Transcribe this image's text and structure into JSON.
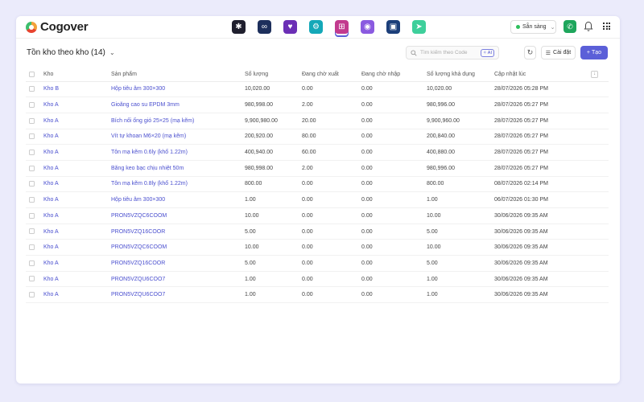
{
  "app": {
    "name": "Cogover"
  },
  "topbar": {
    "apps": [
      {
        "icon": "apps-grid-icon",
        "color": "#1f1f2e",
        "glyph": "✱"
      },
      {
        "icon": "link-icon",
        "color": "#1d2f5c",
        "glyph": "∞"
      },
      {
        "icon": "heart-icon",
        "color": "#6b2fb5",
        "glyph": "♥"
      },
      {
        "icon": "gear-icon",
        "color": "#14a8b8",
        "glyph": "⚙"
      },
      {
        "icon": "org-chart-icon",
        "color": "#c23a8e",
        "glyph": "⊞"
      },
      {
        "icon": "chat-icon",
        "color": "#8a5ae0",
        "glyph": "◉"
      },
      {
        "icon": "warehouse-icon",
        "color": "#1c3f7a",
        "glyph": "▣"
      },
      {
        "icon": "send-icon",
        "color": "#3ecf9b",
        "glyph": "➤"
      }
    ],
    "active_app_index": 4,
    "status": "Sẵn sàng",
    "status_color": "#2ebf5c"
  },
  "page": {
    "title": "Tồn kho theo kho (14)",
    "search_placeholder": "Tìm kiếm theo Code",
    "ai_label": "AI",
    "settings_label": "Cài đặt",
    "create_label": "Tạo"
  },
  "table": {
    "headers": [
      "Kho",
      "Sản phẩm",
      "Số lượng",
      "Đang chờ xuất",
      "Đang chờ nhập",
      "Số lượng khả dụng",
      "Cập nhật lúc"
    ],
    "rows": [
      [
        "Kho B",
        "Hộp tiêu âm 300×300",
        "10,020.00",
        "0.00",
        "0.00",
        "10,020.00",
        "28/07/2026 05:28 PM"
      ],
      [
        "Kho A",
        "Gioăng cao su EPDM 3mm",
        "980,998.00",
        "2.00",
        "0.00",
        "980,996.00",
        "28/07/2026 05:27 PM"
      ],
      [
        "Kho A",
        "Bích nối ống gió 25×25 (mạ kẽm)",
        "9,900,980.00",
        "20.00",
        "0.00",
        "9,900,960.00",
        "28/07/2026 05:27 PM"
      ],
      [
        "Kho A",
        "Vít tự khoan M6×20 (mạ kẽm)",
        "200,920.00",
        "80.00",
        "0.00",
        "200,840.00",
        "28/07/2026 05:27 PM"
      ],
      [
        "Kho A",
        "Tôn mạ kẽm 0.6ly (khổ 1.22m)",
        "400,940.00",
        "60.00",
        "0.00",
        "400,880.00",
        "28/07/2026 05:27 PM"
      ],
      [
        "Kho A",
        "Băng keo bạc chịu nhiệt 50m",
        "980,998.00",
        "2.00",
        "0.00",
        "980,996.00",
        "28/07/2026 05:27 PM"
      ],
      [
        "Kho A",
        "Tôn mạ kẽm 0.8ly (khổ 1.22m)",
        "800.00",
        "0.00",
        "0.00",
        "800.00",
        "08/07/2026 02:14 PM"
      ],
      [
        "Kho A",
        "Hộp tiêu âm 300×300",
        "1.00",
        "0.00",
        "0.00",
        "1.00",
        "06/07/2026 01:30 PM"
      ],
      [
        "Kho A",
        "PRON5VZQC6COOM",
        "10.00",
        "0.00",
        "0.00",
        "10.00",
        "30/06/2026 09:35 AM"
      ],
      [
        "Kho A",
        "PRON5VZQ16COOR",
        "5.00",
        "0.00",
        "0.00",
        "5.00",
        "30/06/2026 09:35 AM"
      ],
      [
        "Kho A",
        "PRON5VZQC6COOM",
        "10.00",
        "0.00",
        "0.00",
        "10.00",
        "30/06/2026 09:35 AM"
      ],
      [
        "Kho A",
        "PRON5VZQ16COOR",
        "5.00",
        "0.00",
        "0.00",
        "5.00",
        "30/06/2026 09:35 AM"
      ],
      [
        "Kho A",
        "PRON5VZQU6COO7",
        "1.00",
        "0.00",
        "0.00",
        "1.00",
        "30/06/2026 09:35 AM"
      ],
      [
        "Kho A",
        "PRON5VZQU6COO7",
        "1.00",
        "0.00",
        "0.00",
        "1.00",
        "30/06/2026 09:35 AM"
      ]
    ]
  }
}
